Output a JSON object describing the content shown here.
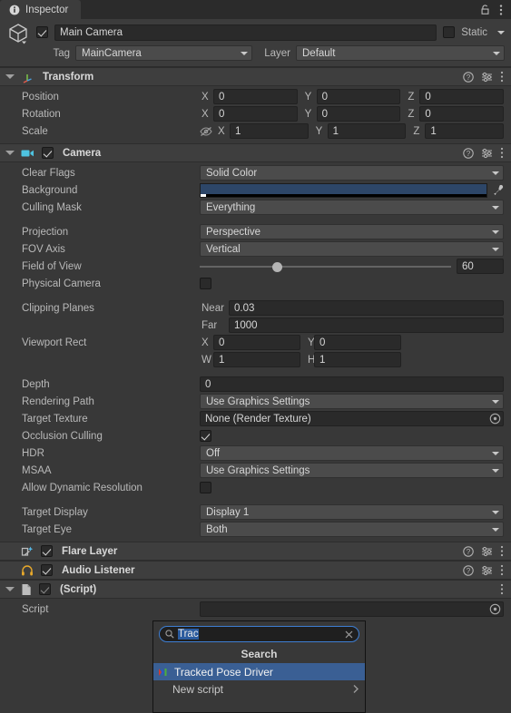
{
  "window": {
    "tab_label": "Inspector",
    "tab_icon": "info-icon",
    "lock_icon": "lock-icon",
    "menu_icon": "kebab-menu-icon"
  },
  "gameobject": {
    "name_value": "Main Camera",
    "enabled": true,
    "static_label": "Static",
    "static_checked": false,
    "tag_label": "Tag",
    "tag_value": "MainCamera",
    "layer_label": "Layer",
    "layer_value": "Default"
  },
  "transform": {
    "title": "Transform",
    "icon": "transform-axes-icon",
    "rows": [
      {
        "label": "Position",
        "x": "0",
        "y": "0",
        "z": "0"
      },
      {
        "label": "Rotation",
        "x": "0",
        "y": "0",
        "z": "0"
      },
      {
        "label": "Scale",
        "x": "1",
        "y": "1",
        "z": "1"
      }
    ],
    "axis_x": "X",
    "axis_y": "Y",
    "axis_z": "Z",
    "scale_lock_icon": "constrain-proportions-off-icon"
  },
  "camera": {
    "title": "Camera",
    "icon": "camera-icon",
    "enabled": true,
    "clear_flags_label": "Clear Flags",
    "clear_flags_value": "Solid Color",
    "background_label": "Background",
    "background_color": "#2d4668",
    "background_alpha_color": "#000000",
    "eyedropper_icon": "eyedropper-icon",
    "culling_mask_label": "Culling Mask",
    "culling_mask_value": "Everything",
    "projection_label": "Projection",
    "projection_value": "Perspective",
    "fov_axis_label": "FOV Axis",
    "fov_axis_value": "Vertical",
    "field_of_view_label": "Field of View",
    "field_of_view_value": "60",
    "field_of_view_percent": 30,
    "physical_camera_label": "Physical Camera",
    "physical_camera_checked": false,
    "clipping_planes_label": "Clipping Planes",
    "near_label": "Near",
    "near_value": "0.03",
    "far_label": "Far",
    "far_value": "1000",
    "viewport_rect_label": "Viewport Rect",
    "viewport_x_label": "X",
    "viewport_x_value": "0",
    "viewport_y_label": "Y",
    "viewport_y_value": "0",
    "viewport_w_label": "W",
    "viewport_w_value": "1",
    "viewport_h_label": "H",
    "viewport_h_value": "1",
    "depth_label": "Depth",
    "depth_value": "0",
    "rendering_path_label": "Rendering Path",
    "rendering_path_value": "Use Graphics Settings",
    "target_texture_label": "Target Texture",
    "target_texture_value": "None (Render Texture)",
    "target_texture_picker_icon": "object-picker-icon",
    "occlusion_culling_label": "Occlusion Culling",
    "occlusion_culling_checked": true,
    "hdr_label": "HDR",
    "hdr_value": "Off",
    "msaa_label": "MSAA",
    "msaa_value": "Use Graphics Settings",
    "allow_dynamic_resolution_label": "Allow Dynamic Resolution",
    "allow_dynamic_resolution_checked": false,
    "target_display_label": "Target Display",
    "target_display_value": "Display 1",
    "target_eye_label": "Target Eye",
    "target_eye_value": "Both"
  },
  "flare_layer": {
    "title": "Flare Layer",
    "icon": "flare-layer-icon",
    "enabled": true
  },
  "audio_listener": {
    "title": "Audio Listener",
    "icon": "headphones-icon",
    "enabled": true
  },
  "script_component": {
    "title": "(Script)",
    "icon": "script-file-icon",
    "enabled": true,
    "script_label": "Script",
    "script_value": "",
    "picker_icon": "object-picker-icon"
  },
  "component_header_icons": {
    "help": "help-icon",
    "settings": "preset-settings-icon",
    "menu": "kebab-menu-icon"
  },
  "search_popup": {
    "search_icon": "magnifier-icon",
    "query": "Trac",
    "clear_icon": "clear-x-icon",
    "title": "Search",
    "items": [
      {
        "label": "Tracked Pose Driver",
        "icon": "script-asset-icon",
        "selected": true,
        "has_submenu": false
      },
      {
        "label": "New script",
        "icon": "",
        "selected": false,
        "has_submenu": true
      }
    ],
    "submenu_icon": "chevron-right-icon",
    "highlight_color": "#3a5f94"
  }
}
